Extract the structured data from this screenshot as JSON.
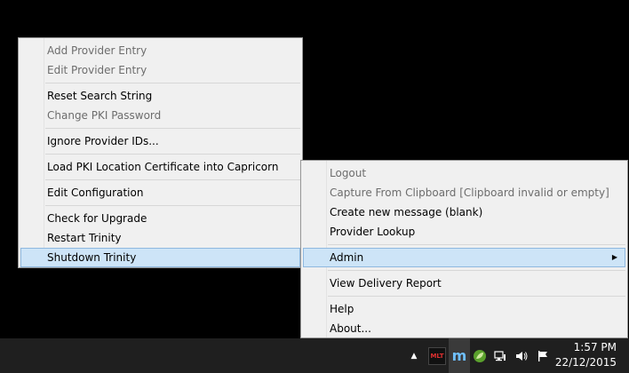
{
  "menu1": {
    "items": [
      {
        "label": "Add Provider Entry",
        "disabled": true
      },
      {
        "label": "Edit Provider Entry",
        "disabled": true
      },
      {
        "label": "Reset Search String",
        "disabled": false
      },
      {
        "label": "Change PKI Password",
        "disabled": true
      },
      {
        "label": "Ignore Provider IDs...",
        "disabled": false
      },
      {
        "label": "Load PKI Location Certificate into Capricorn",
        "disabled": false
      },
      {
        "label": "Edit Configuration",
        "disabled": false
      },
      {
        "label": "Check for Upgrade",
        "disabled": false
      },
      {
        "label": "Restart Trinity",
        "disabled": false
      },
      {
        "label": "Shutdown Trinity",
        "disabled": false,
        "highlighted": true
      }
    ]
  },
  "menu2": {
    "items": [
      {
        "label": "Logout",
        "disabled": true
      },
      {
        "label": "Capture From Clipboard [Clipboard invalid or empty]",
        "disabled": true
      },
      {
        "label": "Create new message (blank)",
        "disabled": false
      },
      {
        "label": "Provider Lookup",
        "disabled": false
      },
      {
        "label": "Admin",
        "disabled": false,
        "highlighted": true,
        "submenu": true
      },
      {
        "label": "View Delivery Report",
        "disabled": false
      },
      {
        "label": "Help",
        "disabled": false
      },
      {
        "label": "About...",
        "disabled": false
      }
    ]
  },
  "taskbar": {
    "mlt_label": "MLT",
    "m_label": "m",
    "time": "1:57 PM",
    "date": "22/12/2015"
  },
  "icons": [
    "chevron-up-icon",
    "mlt-app-icon",
    "m-app-icon",
    "leaf-icon",
    "network-icon",
    "speaker-icon",
    "flag-icon"
  ],
  "colors": {
    "highlight": "#cde4f7",
    "menu_bg": "#f0f0f0",
    "taskbar": "#1f1f1f"
  }
}
